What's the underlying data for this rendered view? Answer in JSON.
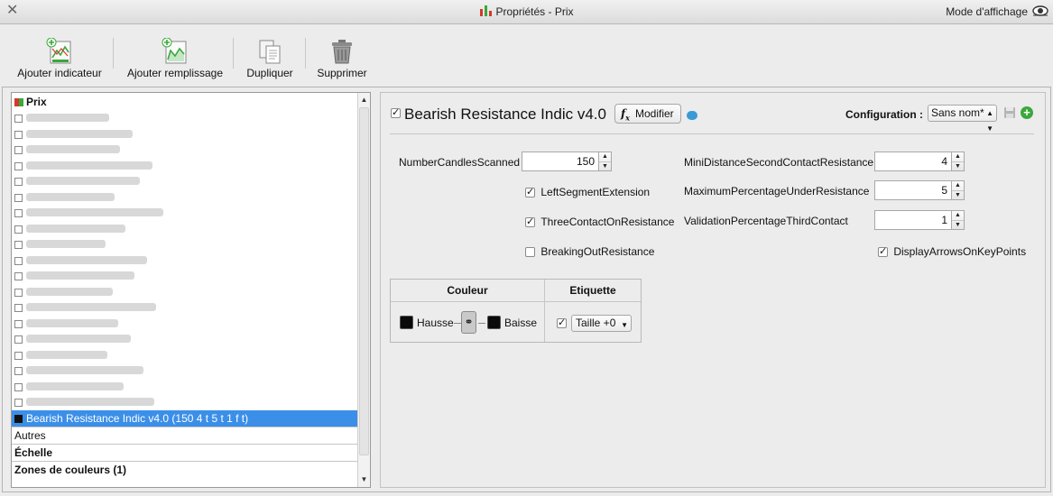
{
  "window": {
    "title": "Propriétés - Prix",
    "mode_label": "Mode d'affichage"
  },
  "toolbar": {
    "add_indicator": "Ajouter indicateur",
    "add_fill": "Ajouter remplissage",
    "duplicate": "Dupliquer",
    "delete": "Supprimer"
  },
  "list": {
    "header": "Prix",
    "blurred_rows": 19,
    "selected": "Bearish Resistance Indic v4.0 (150 4 t 5 t 1 f t)",
    "others": "Autres",
    "scale": "Échelle",
    "zones": "Zones de couleurs (1)"
  },
  "indicator": {
    "name": "Bearish Resistance Indic v4.0",
    "enabled": true,
    "modify_label": "Modifier",
    "config_label": "Configuration :",
    "config_value": "Sans nom*"
  },
  "params": {
    "number_candles": {
      "label": "NumberCandlesScanned",
      "value": "150"
    },
    "left_segment": {
      "label": "LeftSegmentExtension",
      "checked": true
    },
    "three_contact": {
      "label": "ThreeContactOnResistance",
      "checked": true
    },
    "breaking_out": {
      "label": "BreakingOutResistance",
      "checked": false
    },
    "mini_distance": {
      "label": "MiniDistanceSecondContactResistance",
      "value": "4"
    },
    "max_percentage": {
      "label": "MaximumPercentageUnderResistance",
      "value": "5"
    },
    "validation_percentage": {
      "label": "ValidationPercentageThirdContact",
      "value": "1"
    },
    "display_arrows": {
      "label": "DisplayArrowsOnKeyPoints",
      "checked": true
    }
  },
  "colors": {
    "header_color": "Couleur",
    "header_label": "Etiquette",
    "up_label": "Hausse",
    "down_label": "Baisse",
    "up_color": "#0a0a0a",
    "down_color": "#0a0a0a",
    "label_enabled": true,
    "size_value": "Taille +0"
  }
}
